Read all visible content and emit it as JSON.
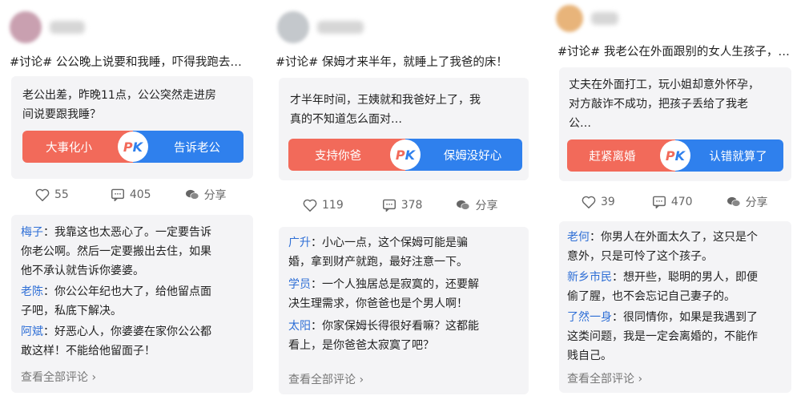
{
  "columns": [
    {
      "post_title": "#讨论# 公公晚上说要和我睡，吓得我跑去…",
      "card_lines": [
        "老公出差，昨晚11点，公公突然走进房",
        "间说要跟我睡？"
      ],
      "pk_left": "大事化小",
      "pk_right": "告诉老公",
      "pk_badge_p": "P",
      "pk_badge_k": "K",
      "likes": "55",
      "comments_count": "405",
      "share_label": "分享",
      "comments": [
        {
          "name": "梅子",
          "lines": [
            "：我靠这也太恶心了。一定要告诉",
            "你老公啊。然后一定要搬出去住，如果",
            "他不承认就告诉你婆婆。"
          ]
        },
        {
          "name": "老陈",
          "lines": [
            "：你公公年纪也大了，给他留点面",
            "子吧，私底下解决。"
          ]
        },
        {
          "name": "阿斌",
          "lines": [
            "：好恶心人，你婆婆在家你公公都",
            "敢这样！不能给他留面子！"
          ]
        }
      ],
      "view_all": "查看全部评论",
      "avatar_color": "#c9a0b0"
    },
    {
      "post_title": "#讨论# 保姆才来半年，就睡上了我爸的床！",
      "card_lines": [
        "才半年时间，王姨就和我爸好上了，我",
        "真的不知道怎么面对…"
      ],
      "pk_left": "支持你爸",
      "pk_right": "保姆没好心",
      "pk_badge_p": "P",
      "pk_badge_k": "K",
      "likes": "119",
      "comments_count": "378",
      "share_label": "分享",
      "comments": [
        {
          "name": "广升",
          "lines": [
            "：小心一点，这个保姆可能是骗",
            "婚，拿到财产就跑，最好注意一下。"
          ]
        },
        {
          "name": "学员",
          "lines": [
            "：一个人独居总是寂寞的，还要解",
            "决生理需求，你爸爸也是个男人啊！"
          ]
        },
        {
          "name": "太阳",
          "lines": [
            "：你家保姆长得很好看嘛？这都能",
            "看上，是你爸爸太寂寞了吧？"
          ]
        }
      ],
      "view_all": "查看全部评论",
      "avatar_color": "#c4c8cc"
    },
    {
      "post_title": "#讨论# 我老公在外面跟别的女人生孩子，…",
      "card_lines": [
        "丈夫在外面打工，玩小姐却意外怀孕，",
        "对方敲诈不成功，把孩子丢给了我老",
        "公…"
      ],
      "pk_left": "赶紧离婚",
      "pk_right": "认错就算了",
      "pk_badge_p": "P",
      "pk_badge_k": "K",
      "likes": "39",
      "comments_count": "470",
      "share_label": "分享",
      "comments": [
        {
          "name": "老何",
          "lines": [
            "：你男人在外面太久了，这只是个",
            "意外，只是可怜了这个孩子。"
          ]
        },
        {
          "name": "新乡市民",
          "lines": [
            "：想开些，聪明的男人，即便",
            "偷了腥，也不会忘记自己妻子的。"
          ]
        },
        {
          "name": "了然一身",
          "lines": [
            "：很同情你，如果是我遇到了",
            "这类问题，我是一定会离婚的，不能作",
            "贱自己。"
          ]
        }
      ],
      "view_all": "查看全部评论",
      "avatar_color": "#e8b47a"
    }
  ]
}
